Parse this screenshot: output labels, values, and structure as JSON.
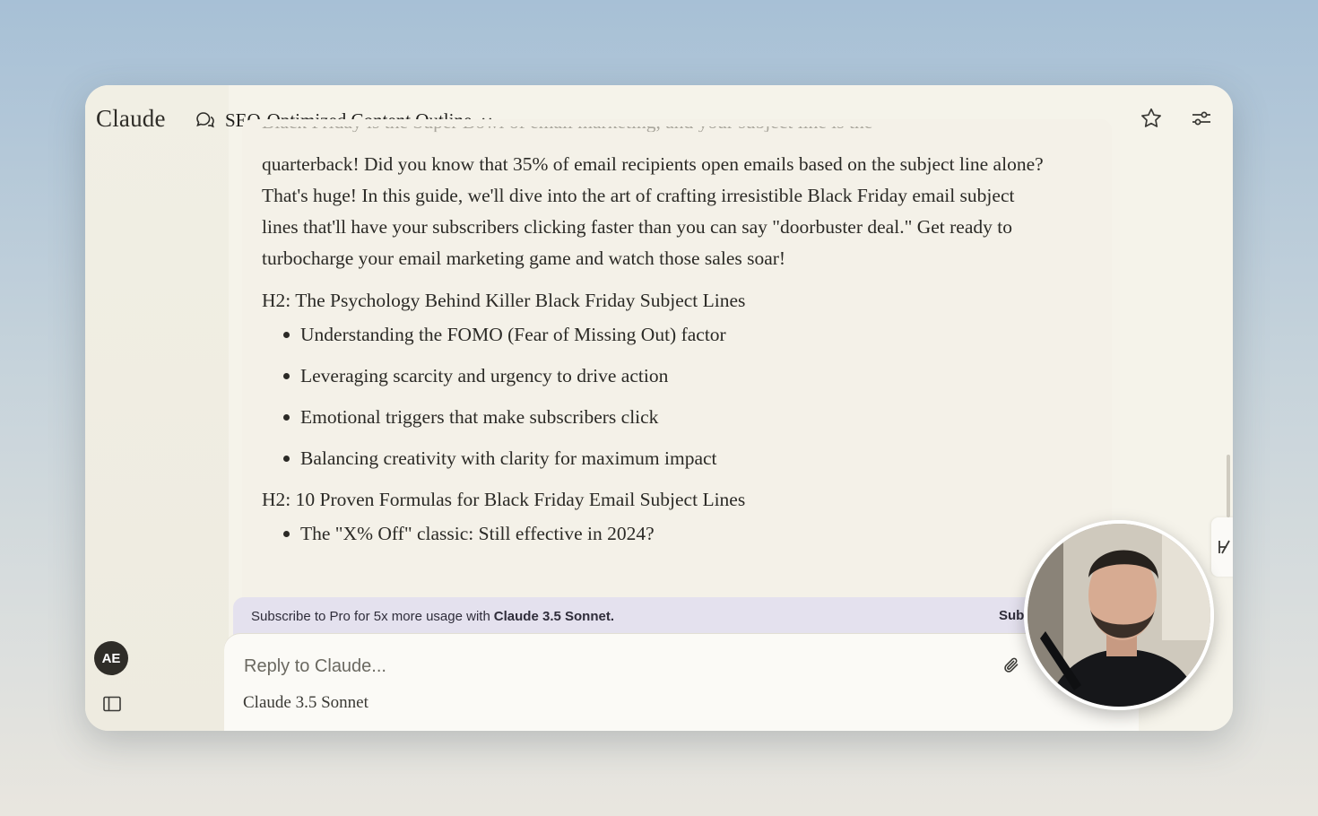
{
  "app": {
    "brand": "Claude",
    "conversation_title": "SEO-Optimized Content Outline"
  },
  "message": {
    "intro_faded": "Black Friday is the Super Bowl of email marketing, and your subject line is the",
    "intro": "quarterback! Did you know that 35% of email recipients open emails based on the subject line alone? That's huge! In this guide, we'll dive into the art of crafting irresistible Black Friday email subject lines that'll have your subscribers clicking faster than you can say \"doorbuster deal.\" Get ready to turbocharge your email marketing game and watch those sales soar!",
    "sections": [
      {
        "heading": "H2: The Psychology Behind Killer Black Friday Subject Lines",
        "items": [
          "Understanding the FOMO (Fear of Missing Out) factor",
          "Leveraging scarcity and urgency to drive action",
          "Emotional triggers that make subscribers click",
          "Balancing creativity with clarity for maximum impact"
        ]
      },
      {
        "heading": "H2: 10 Proven Formulas for Black Friday Email Subject Lines",
        "items": [
          "The \"X% Off\" classic: Still effective in 2024?"
        ]
      }
    ]
  },
  "promo": {
    "text": "Subscribe to Pro for 5x more usage with",
    "model": "Claude 3.5 Sonnet.",
    "cta": "Sub"
  },
  "composer": {
    "placeholder": "Reply to Claude...",
    "model_label": "Claude 3.5 Sonnet"
  },
  "user": {
    "initials": "AE"
  },
  "icons": {
    "chat": "chat-bubbles-icon",
    "chevron": "chevron-down-icon",
    "star": "star-icon",
    "settings": "sliders-icon",
    "attach": "paperclip-icon",
    "sidebar": "sidebar-toggle-icon"
  }
}
